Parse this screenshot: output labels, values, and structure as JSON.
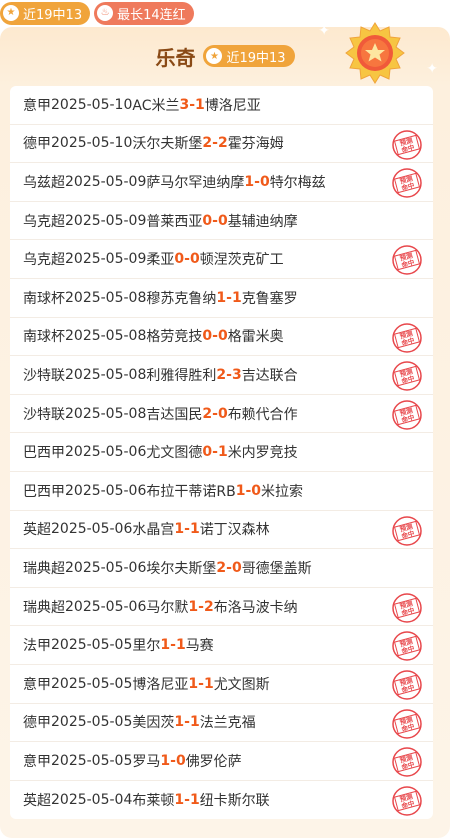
{
  "tags": {
    "hit_label": "近19中13",
    "streak_label": "最长14连红",
    "hit_icon": "star-icon",
    "streak_icon": "flame-icon"
  },
  "header": {
    "title": "乐奇",
    "badge": "近19中13",
    "stamp_text": "预测命中"
  },
  "colors": {
    "accent_orange": "#f0a43b",
    "score_red": "#f05a1a",
    "stamp_red": "#e8474b",
    "title_brown": "#8a4a16"
  },
  "matches": [
    {
      "league": "意甲",
      "date": "2025-05-10",
      "home": "AC米兰",
      "home_score": "3",
      "away_score": "1",
      "away": "博洛尼亚",
      "hit": false
    },
    {
      "league": "德甲",
      "date": "2025-05-10",
      "home": "沃尔夫斯堡",
      "home_score": "2",
      "away_score": "2",
      "away": "霍芬海姆",
      "hit": true
    },
    {
      "league": "乌兹超",
      "date": "2025-05-09",
      "home": "萨马尔罕迪纳摩",
      "home_score": "1",
      "away_score": "0",
      "away": "特尔梅兹",
      "hit": true
    },
    {
      "league": "乌克超",
      "date": "2025-05-09",
      "home": "普莱西亚",
      "home_score": "0",
      "away_score": "0",
      "away": "基辅迪纳摩",
      "hit": false
    },
    {
      "league": "乌克超",
      "date": "2025-05-09",
      "home": "柔亚",
      "home_score": "0",
      "away_score": "0",
      "away": "顿涅茨克矿工",
      "hit": true
    },
    {
      "league": "南球杯",
      "date": "2025-05-08",
      "home": "穆苏克鲁纳",
      "home_score": "1",
      "away_score": "1",
      "away": "克鲁塞罗",
      "hit": false
    },
    {
      "league": "南球杯",
      "date": "2025-05-08",
      "home": "格劳竞技",
      "home_score": "0",
      "away_score": "0",
      "away": "格雷米奥",
      "hit": true
    },
    {
      "league": "沙特联",
      "date": "2025-05-08",
      "home": "利雅得胜利",
      "home_score": "2",
      "away_score": "3",
      "away": "吉达联合",
      "hit": true
    },
    {
      "league": "沙特联",
      "date": "2025-05-08",
      "home": "吉达国民",
      "home_score": "2",
      "away_score": "0",
      "away": "布赖代合作",
      "hit": true
    },
    {
      "league": "巴西甲",
      "date": "2025-05-06",
      "home": "尤文图德",
      "home_score": "0",
      "away_score": "1",
      "away": "米内罗竞技",
      "hit": false
    },
    {
      "league": "巴西甲",
      "date": "2025-05-06",
      "home": "布拉干蒂诺RB",
      "home_score": "1",
      "away_score": "0",
      "away": "米拉索",
      "hit": false
    },
    {
      "league": "英超",
      "date": "2025-05-06",
      "home": "水晶宫",
      "home_score": "1",
      "away_score": "1",
      "away": "诺丁汉森林",
      "hit": true
    },
    {
      "league": "瑞典超",
      "date": "2025-05-06",
      "home": "埃尔夫斯堡",
      "home_score": "2",
      "away_score": "0",
      "away": "哥德堡盖斯",
      "hit": false
    },
    {
      "league": "瑞典超",
      "date": "2025-05-06",
      "home": "马尔默",
      "home_score": "1",
      "away_score": "2",
      "away": "布洛马波卡纳",
      "hit": true
    },
    {
      "league": "法甲",
      "date": "2025-05-05",
      "home": "里尔",
      "home_score": "1",
      "away_score": "1",
      "away": "马赛",
      "hit": true
    },
    {
      "league": "意甲",
      "date": "2025-05-05",
      "home": "博洛尼亚",
      "home_score": "1",
      "away_score": "1",
      "away": "尤文图斯",
      "hit": true
    },
    {
      "league": "德甲",
      "date": "2025-05-05",
      "home": "美因茨",
      "home_score": "1",
      "away_score": "1",
      "away": "法兰克福",
      "hit": true
    },
    {
      "league": "意甲",
      "date": "2025-05-05",
      "home": "罗马",
      "home_score": "1",
      "away_score": "0",
      "away": "佛罗伦萨",
      "hit": true
    },
    {
      "league": "英超",
      "date": "2025-05-04",
      "home": "布莱顿",
      "home_score": "1",
      "away_score": "1",
      "away": "纽卡斯尔联",
      "hit": true
    }
  ]
}
